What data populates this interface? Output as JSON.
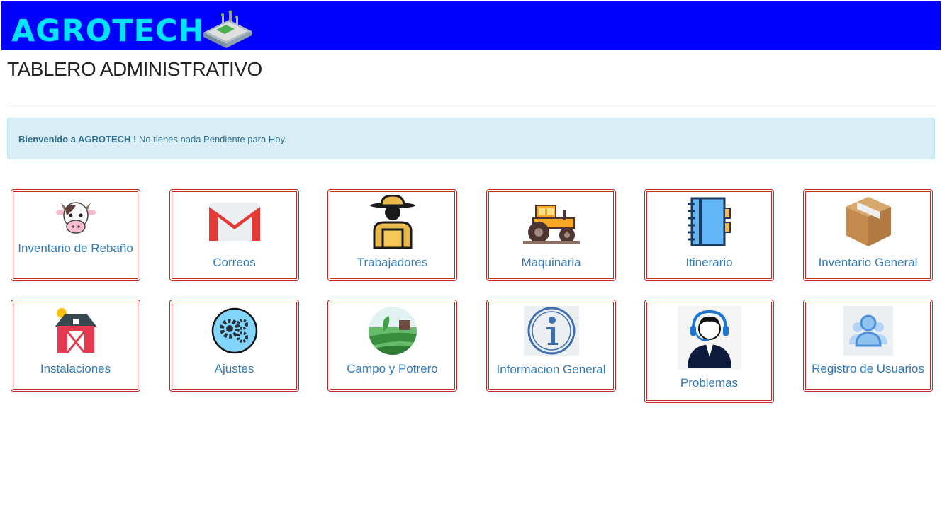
{
  "brand": {
    "name": "AGROTECH"
  },
  "page": {
    "title": "TABLERO ADMINISTRATIVO"
  },
  "alert": {
    "strong": "Bienvenido a AGROTECH !",
    "text": " No tienes nada Pendiente para Hoy."
  },
  "tiles": [
    {
      "label": "Inventario de Rebaño",
      "icon": "cow-icon"
    },
    {
      "label": "Correos",
      "icon": "gmail-icon"
    },
    {
      "label": "Trabajadores",
      "icon": "farmer-icon"
    },
    {
      "label": "Maquinaria",
      "icon": "tractor-icon"
    },
    {
      "label": "Itinerario",
      "icon": "notebook-icon"
    },
    {
      "label": "Inventario General",
      "icon": "box-icon"
    },
    {
      "label": "Instalaciones",
      "icon": "barn-icon"
    },
    {
      "label": "Ajustes",
      "icon": "gears-icon"
    },
    {
      "label": "Campo y Potrero",
      "icon": "field-icon"
    },
    {
      "label": "Informacion General",
      "icon": "info-icon"
    },
    {
      "label": "Problemas",
      "icon": "support-agent-icon"
    },
    {
      "label": "Registro de Usuarios",
      "icon": "users-icon"
    }
  ],
  "colors": {
    "header": "#0000ff",
    "brand": "#00e5ff",
    "tile_border": "#c62828",
    "link": "#337ab7"
  }
}
